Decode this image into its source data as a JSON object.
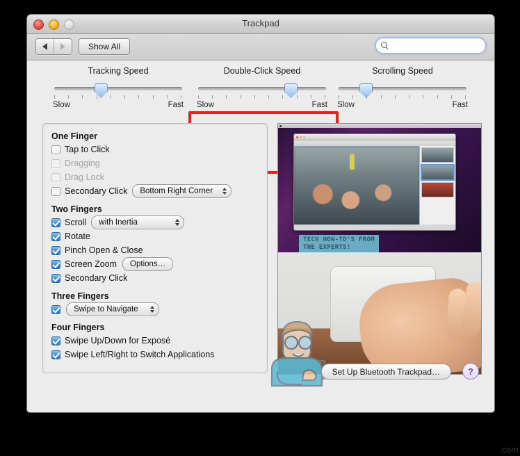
{
  "window": {
    "title": "Trackpad",
    "traffic_lights": [
      "close",
      "minimize",
      "zoom"
    ]
  },
  "toolbar": {
    "back_label": "back-arrow",
    "forward_label": "forward-arrow",
    "show_all_label": "Show All",
    "search_value": "",
    "search_placeholder": ""
  },
  "sliders": [
    {
      "title": "Tracking Speed",
      "min_label": "Slow",
      "max_label": "Fast",
      "value_pct": 36,
      "ticks": 10
    },
    {
      "title": "Double-Click Speed",
      "min_label": "Slow",
      "max_label": "Fast",
      "value_pct": 72,
      "ticks": 10
    },
    {
      "title": "Scrolling Speed",
      "min_label": "Slow",
      "max_label": "Fast",
      "value_pct": 21,
      "ticks": 10
    }
  ],
  "annotation": {
    "color": "#e8211c",
    "targets": "Double-Click Speed"
  },
  "groups": {
    "one_finger": {
      "heading": "One Finger",
      "rows": [
        {
          "label": "Tap to Click",
          "checked": false,
          "disabled": false
        },
        {
          "label": "Dragging",
          "checked": false,
          "disabled": true
        },
        {
          "label": "Drag Lock",
          "checked": false,
          "disabled": true
        },
        {
          "label": "Secondary Click",
          "checked": false,
          "disabled": false,
          "popup": "Bottom Right Corner"
        }
      ]
    },
    "two_fingers": {
      "heading": "Two Fingers",
      "rows": [
        {
          "label": "Scroll",
          "checked": true,
          "popup": "with Inertia"
        },
        {
          "label": "Rotate",
          "checked": true
        },
        {
          "label": "Pinch Open & Close",
          "checked": true
        },
        {
          "label": "Screen Zoom",
          "checked": true,
          "button": "Options…"
        },
        {
          "label": "Secondary Click",
          "checked": true
        }
      ]
    },
    "three_fingers": {
      "heading": "Three Fingers",
      "rows": [
        {
          "label": "",
          "checked": true,
          "popup": "Swipe to Navigate"
        }
      ]
    },
    "four_fingers": {
      "heading": "Four Fingers",
      "rows": [
        {
          "label": "Swipe Up/Down for Exposé",
          "checked": true
        },
        {
          "label": "Swipe Left/Right to Switch Applications",
          "checked": true
        }
      ]
    }
  },
  "video": {
    "caption_line1": "TECH HOW-TO'S FROM",
    "caption_line2": "THE EXPERTS!"
  },
  "footer": {
    "bluetooth_label": "Set Up Bluetooth Trackpad…",
    "help_label": "?"
  },
  "watermark": ".com"
}
